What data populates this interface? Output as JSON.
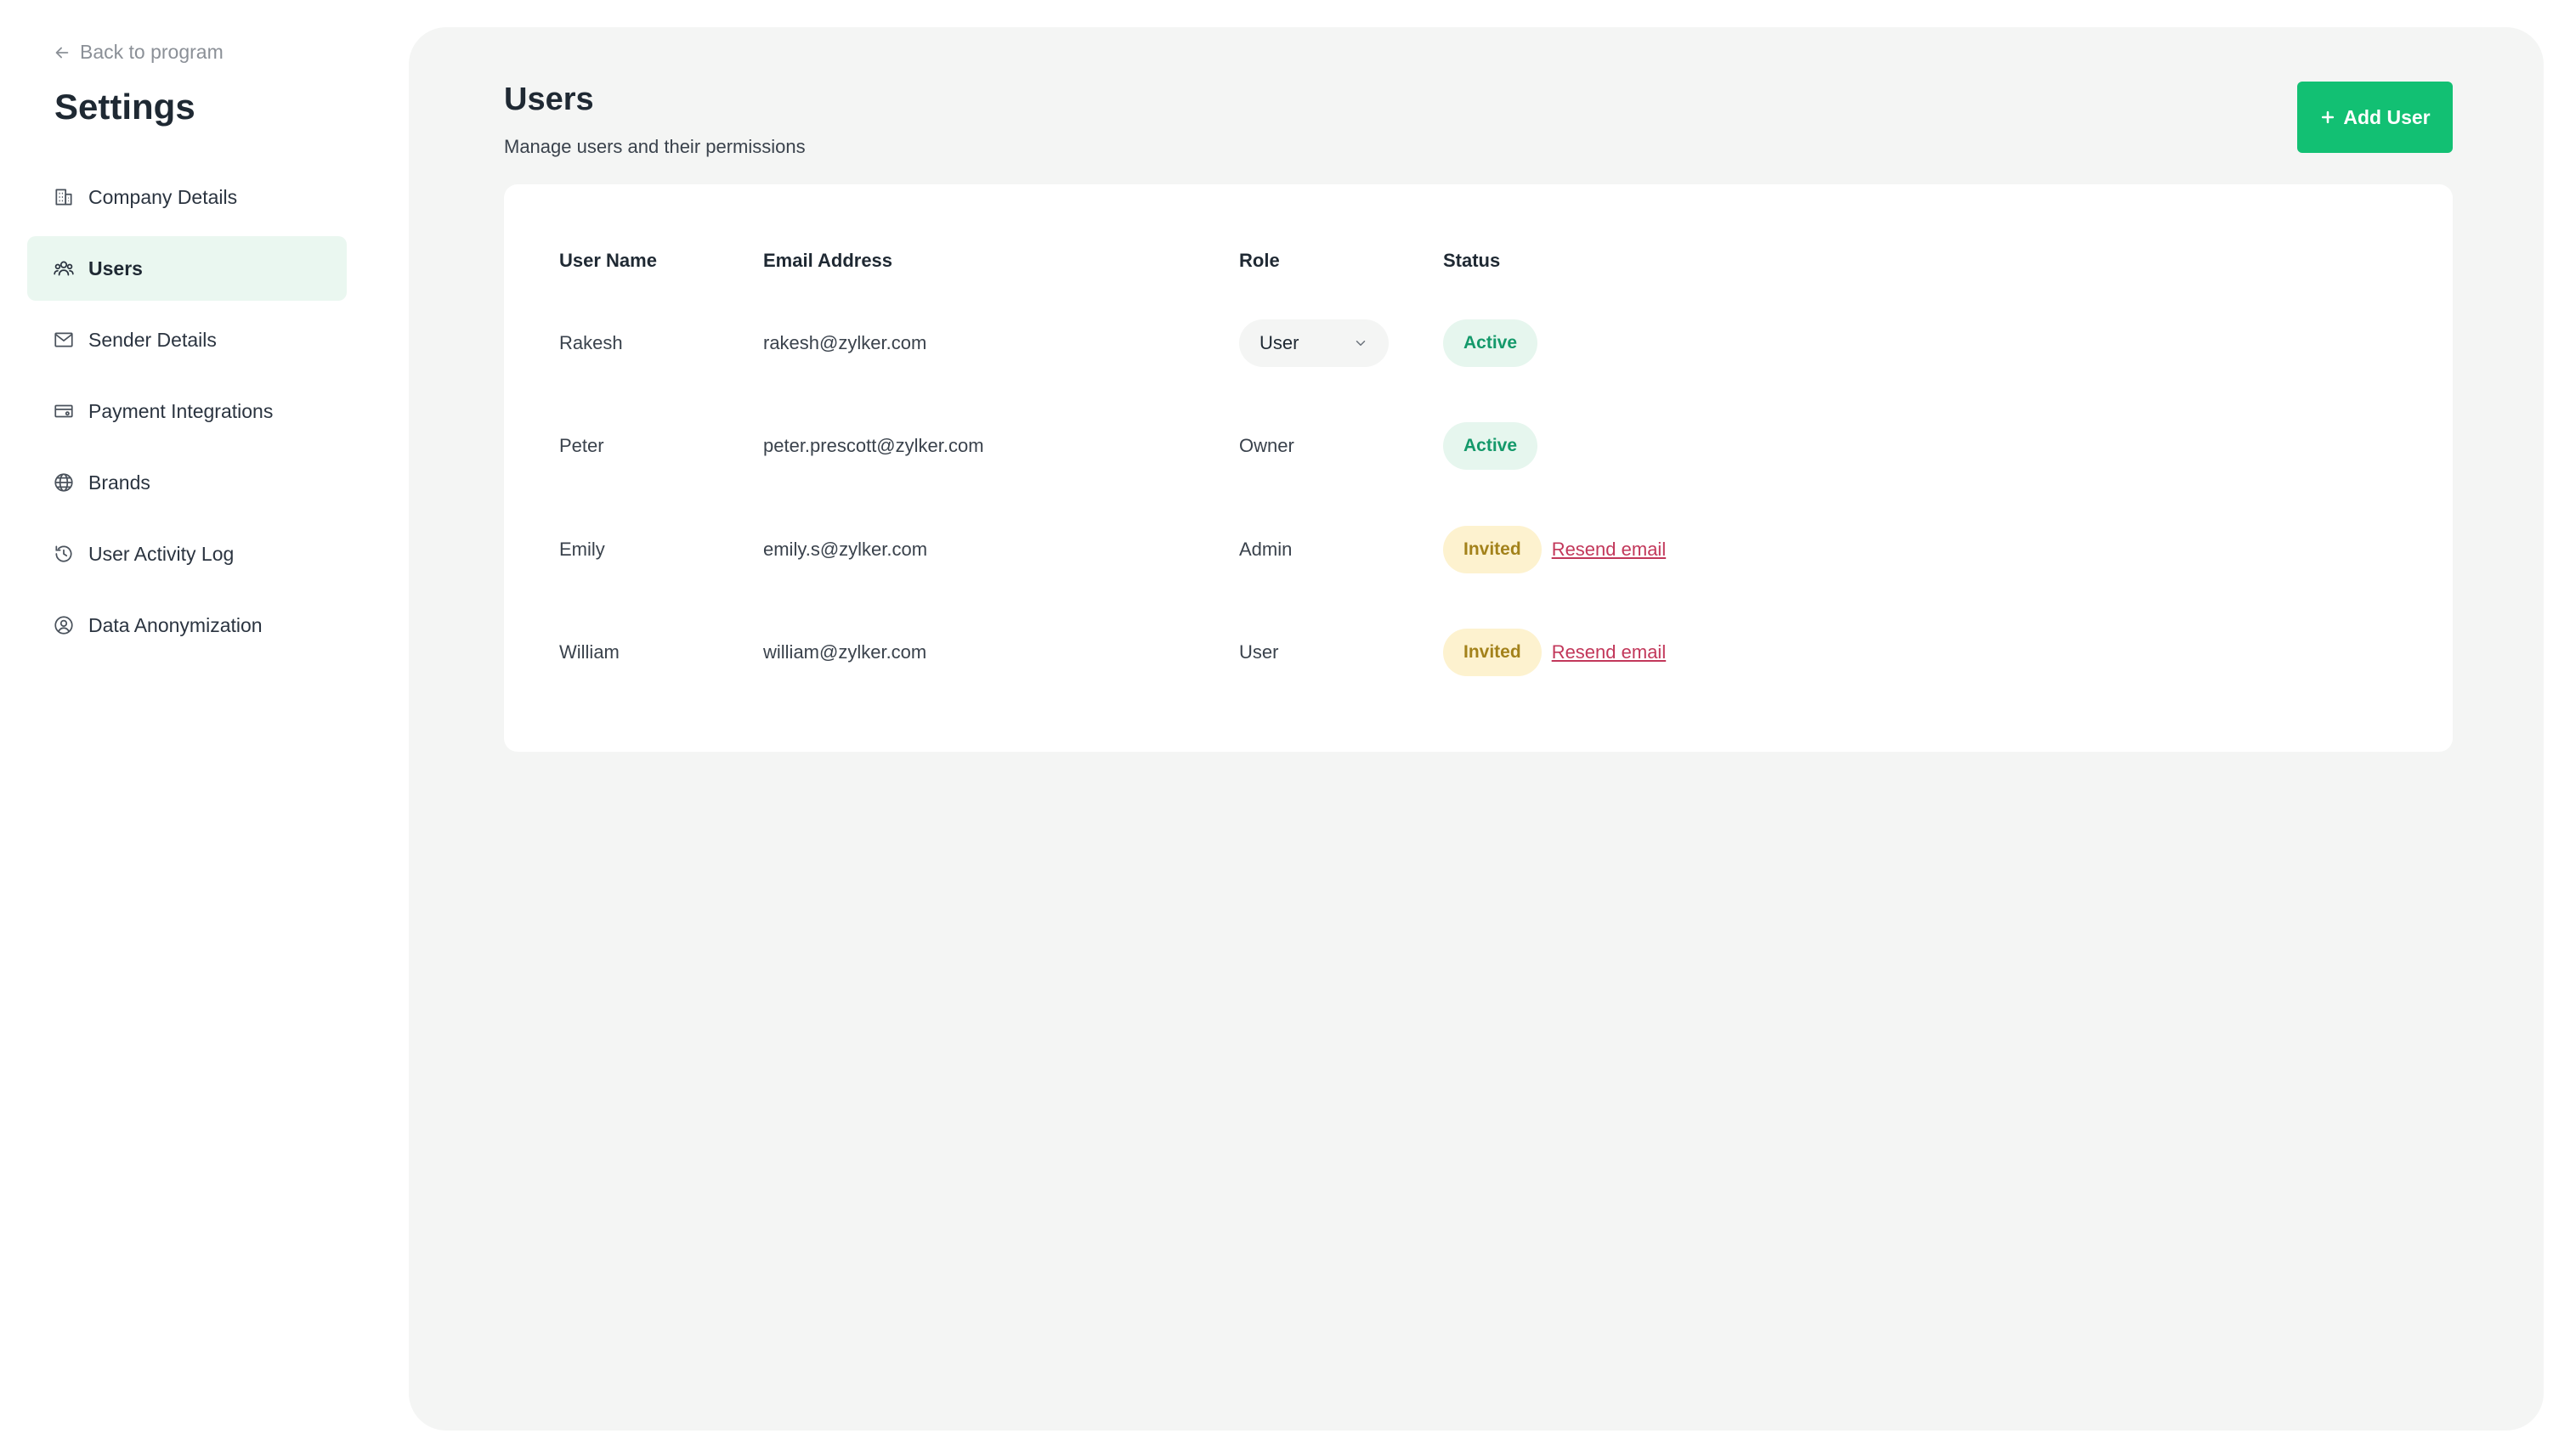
{
  "sidebar": {
    "back_label": "Back to program",
    "title": "Settings",
    "items": [
      {
        "label": "Company Details",
        "icon": "building-icon"
      },
      {
        "label": "Users",
        "icon": "users-icon",
        "active": true
      },
      {
        "label": "Sender Details",
        "icon": "mail-icon"
      },
      {
        "label": "Payment Integrations",
        "icon": "payment-card-icon"
      },
      {
        "label": "Brands",
        "icon": "globe-icon"
      },
      {
        "label": "User Activity Log",
        "icon": "history-icon"
      },
      {
        "label": "Data Anonymization",
        "icon": "anonymous-user-icon"
      }
    ]
  },
  "main": {
    "title": "Users",
    "subtitle": "Manage users and their permissions",
    "add_button": "Add User",
    "table": {
      "headers": {
        "name": "User Name",
        "email": "Email Address",
        "role": "Role",
        "status": "Status"
      },
      "rows": [
        {
          "name": "Rakesh",
          "email": "rakesh@zylker.com",
          "role": "User",
          "role_editable": true,
          "status": "Active"
        },
        {
          "name": "Peter",
          "email": "peter.prescott@zylker.com",
          "role": "Owner",
          "status": "Active"
        },
        {
          "name": "Emily",
          "email": "emily.s@zylker.com",
          "role": "Admin",
          "status": "Invited",
          "action": "Resend email"
        },
        {
          "name": "William",
          "email": "william@zylker.com",
          "role": "User",
          "status": "Invited",
          "action": "Resend email"
        }
      ]
    }
  },
  "colors": {
    "accent": "#12c073",
    "active_badge_bg": "#e6f6ee",
    "active_badge_text": "#14996a",
    "invited_badge_bg": "#fdf2cf",
    "invited_badge_text": "#a3821b",
    "link": "#c2375a",
    "sidebar_active_bg": "#eaf7f0"
  }
}
